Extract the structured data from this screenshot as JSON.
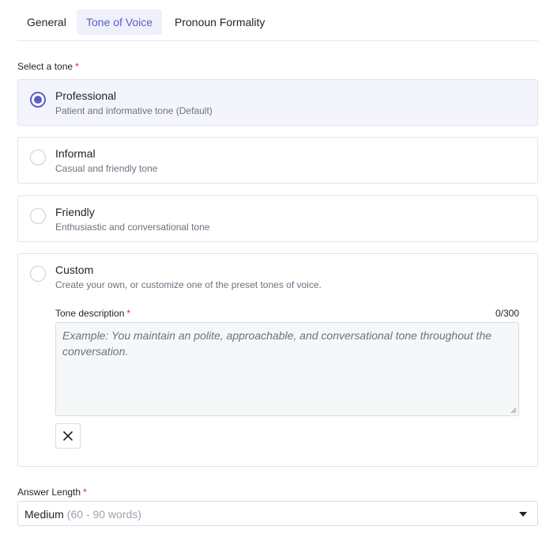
{
  "tabs": [
    {
      "label": "General"
    },
    {
      "label": "Tone of Voice"
    },
    {
      "label": "Pronoun Formality"
    }
  ],
  "active_tab": "Tone of Voice",
  "tone_section": {
    "label": "Select a tone",
    "required_mark": "*"
  },
  "tones": [
    {
      "title": "Professional",
      "description": "Patient and informative tone (Default)",
      "selected": true
    },
    {
      "title": "Informal",
      "description": "Casual and friendly tone",
      "selected": false
    },
    {
      "title": "Friendly",
      "description": "Enthusiastic and conversational tone",
      "selected": false
    },
    {
      "title": "Custom",
      "description": "Create your own, or customize one of the preset tones of voice.",
      "selected": false
    }
  ],
  "custom": {
    "field_label": "Tone description",
    "required_mark": "*",
    "counter": "0/300",
    "value": "",
    "placeholder": "Example: You maintain an polite, approachable, and conversational tone throughout the conversation."
  },
  "answer_length": {
    "label": "Answer Length",
    "required_mark": "*",
    "selected_value": "Medium",
    "selected_hint": "(60 - 90 words)"
  },
  "colors": {
    "accent": "#5b5fc7",
    "required": "#d92c2c",
    "selected_bg": "#f4f5fc"
  }
}
